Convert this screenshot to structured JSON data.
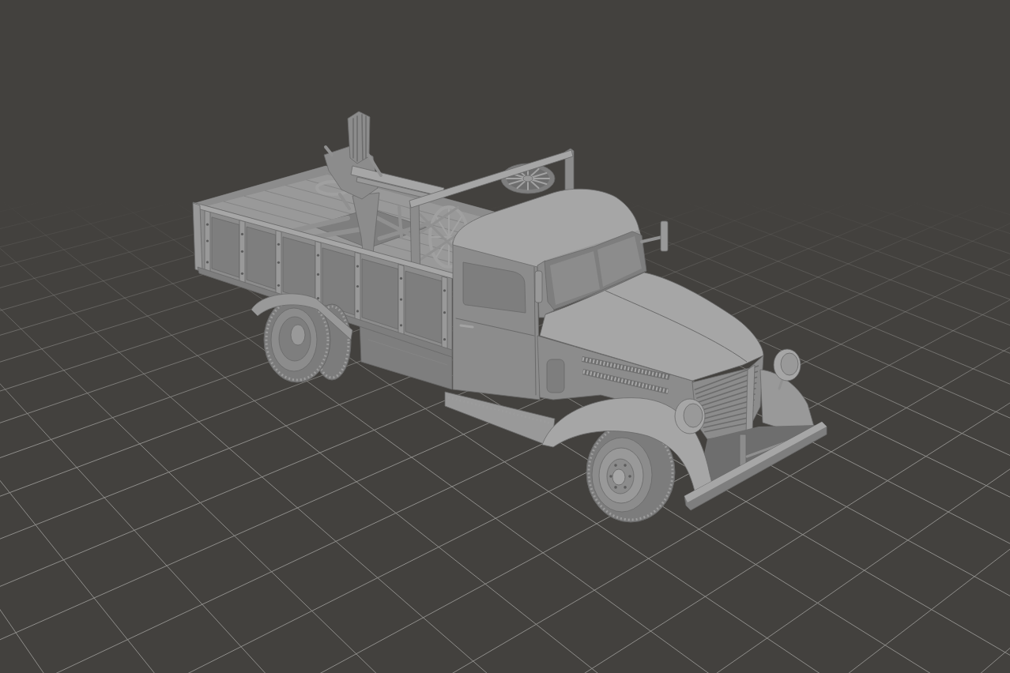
{
  "viewport": {
    "grid_visible": true,
    "model": {
      "kind": "truck"
    }
  }
}
